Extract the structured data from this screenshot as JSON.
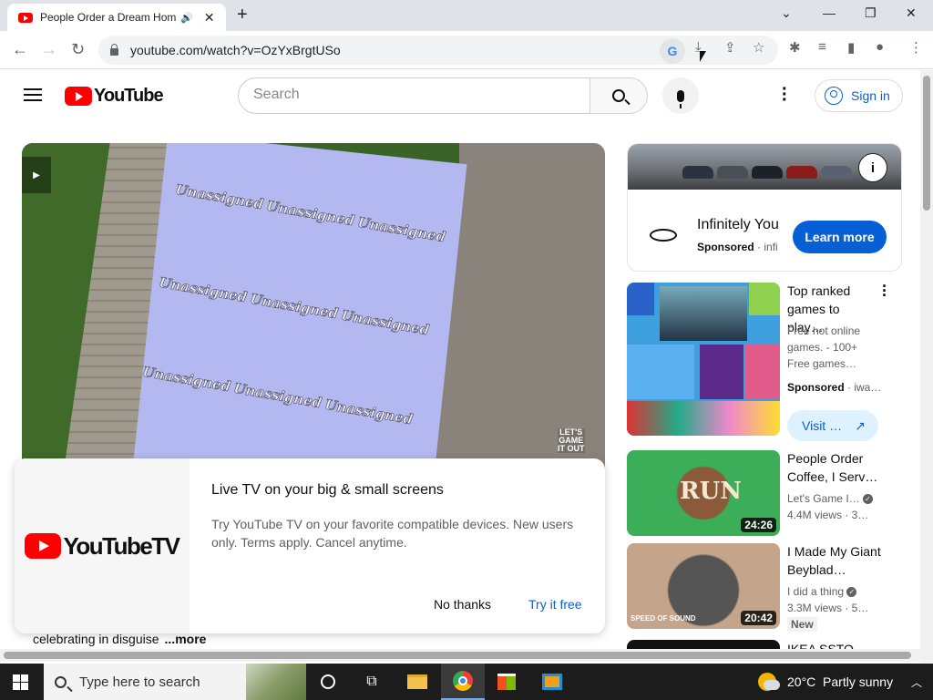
{
  "browser": {
    "tab_title": "People Order a Dream Hom",
    "url": "youtube.com/watch?v=OzYxBrgtUSo",
    "new_tab_symbol": "+",
    "audio_symbol": "🔊",
    "close_symbol": "✕"
  },
  "youtube": {
    "logo_text": "YouTube",
    "search_placeholder": "Search",
    "sign_in": "Sign in"
  },
  "video": {
    "floor_label": "Unassigned",
    "watermark": "LET'S\nGAME\nIT OUT"
  },
  "promo": {
    "logo_text": "YouTubeTV",
    "title": "Live TV on your big & small screens",
    "description": "Try YouTube TV on your favorite compatible devices. New users only. Terms apply. Cancel anytime.",
    "no_thanks": "No thanks",
    "try_free": "Try it free"
  },
  "description_snippet": {
    "text": "celebrating in disguise",
    "more": "...more"
  },
  "sidebar": {
    "ad": {
      "name": "Infinitely You",
      "sponsored": "Sponsored",
      "advertiser": "infi",
      "learn_more": "Learn more"
    },
    "game_ad": {
      "title": "Top ranked games to play…",
      "description": "Free hot online games. - 100+ Free games…",
      "sponsored": "Sponsored",
      "advertiser": "iwa…",
      "visit": "Visit …"
    },
    "videos": [
      {
        "title": "People Order Coffee, I Serv…",
        "channel": "Let's Game I…",
        "meta": "4.4M views · 3…",
        "duration": "24:26",
        "thumb_text": "RUN"
      },
      {
        "title": "I Made My Giant Beyblad…",
        "channel": "I did a thing",
        "meta": "3.3M views · 5…",
        "duration": "20:42",
        "badge": "New",
        "thumb_text": "SPEED OF SOUND"
      },
      {
        "title": "IKEA SSTO"
      }
    ]
  },
  "taskbar": {
    "search_placeholder": "Type here to search",
    "weather": "20°C  Partly sunny"
  }
}
